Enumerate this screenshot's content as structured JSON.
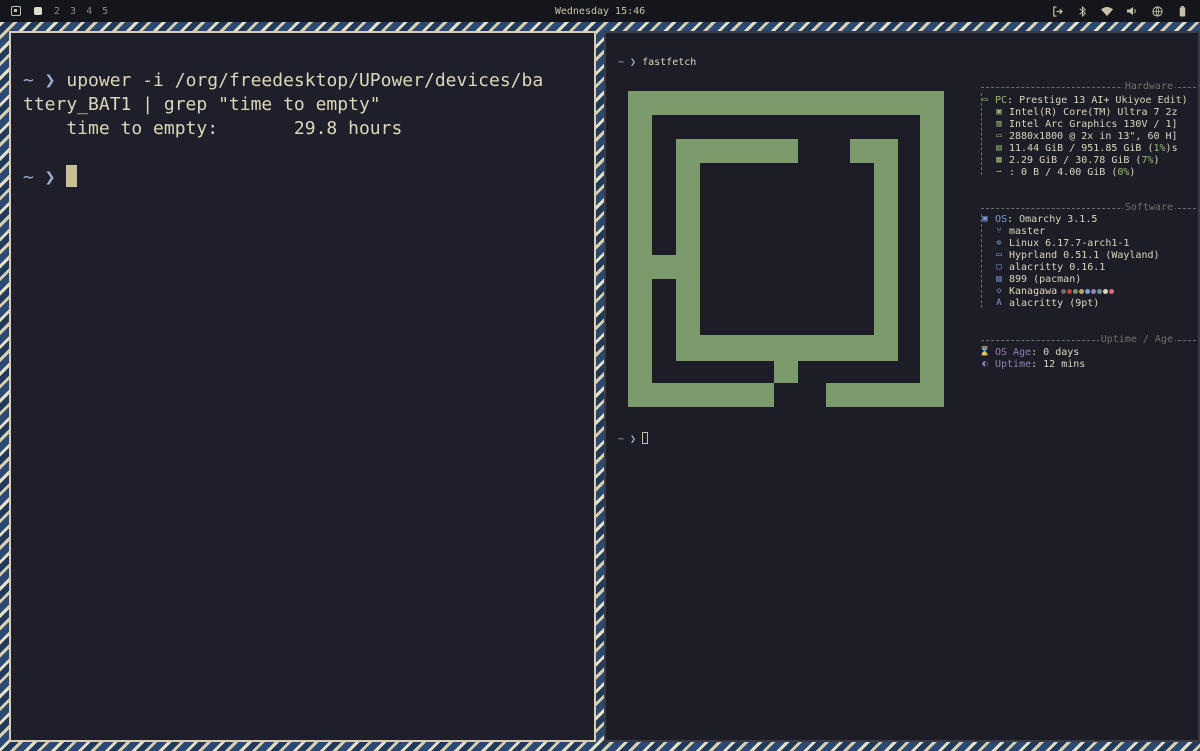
{
  "topbar": {
    "workspaces": [
      "2",
      "3",
      "4",
      "5"
    ],
    "clock": "Wednesday 15:46"
  },
  "left_terminal": {
    "prompt_symbol": "~ ❯",
    "command_line1": "upower -i /org/freedesktop/UPower/devices/ba",
    "command_line2": "ttery_BAT1 | grep \"time to empty\"",
    "output": "    time to empty:       29.8 hours"
  },
  "right_terminal": {
    "prompt_symbol": "~ ❯",
    "command": "fastfetch",
    "sections": {
      "hardware": "Hardware",
      "software": "Software",
      "uptime": "Uptime / Age"
    },
    "hardware": [
      {
        "icon": "pc-icon",
        "key": "PC",
        "value": "Prestige 13 AI+ Ukiyoe Edit)"
      },
      {
        "icon": "cpu-icon",
        "key": "",
        "value": "Intel(R) Core(TM) Ultra 7 2z"
      },
      {
        "icon": "gpu-icon",
        "key": "",
        "value": "Intel Arc Graphics 130V / 1]"
      },
      {
        "icon": "display-icon",
        "key": "",
        "value": "2880x1800 @ 2x in 13\", 60 H]"
      },
      {
        "icon": "disk-icon",
        "key": "",
        "value": "11.44 GiB / 951.85 GiB (",
        "pct": "1%",
        "tail": ")s"
      },
      {
        "icon": "memory-icon",
        "key": "",
        "value": "2.29 GiB / 30.78 GiB (",
        "pct": "7%",
        "tail": ")"
      },
      {
        "icon": "swap-icon",
        "key": "",
        "value": ": 0 B / 4.00 GiB (",
        "pct": "0%",
        "tail": ")"
      }
    ],
    "software": [
      {
        "icon": "os-icon",
        "key": "OS",
        "value": "Omarchy 3.1.5"
      },
      {
        "icon": "branch-icon",
        "key": "",
        "value": "master"
      },
      {
        "icon": "kernel-gear-icon",
        "key": "",
        "value": "Linux 6.17.7-arch1-1"
      },
      {
        "icon": "window-manager-icon",
        "key": "",
        "value": "Hyprland 0.51.1 (Wayland)"
      },
      {
        "icon": "terminal-icon",
        "key": "",
        "value": "alacritty 0.16.1"
      },
      {
        "icon": "package-icon",
        "key": "",
        "value": "899 (pacman)"
      },
      {
        "icon": "theme-icon",
        "key": "",
        "value": "Kanagawa"
      },
      {
        "icon": "font-icon",
        "key": "",
        "value": "alacritty (9pt)"
      }
    ],
    "uptime": [
      {
        "icon": "hourglass-icon",
        "key": "OS Age",
        "value": ": 0 days"
      },
      {
        "icon": "uptime-icon",
        "key": "Uptime",
        "value": ": 12 mins"
      }
    ],
    "theme_swatches": [
      "#727169",
      "#c34043",
      "#76946a",
      "#c0a36e",
      "#7e9cd8",
      "#957fb8",
      "#6a9589",
      "#dcd7ba",
      "#e46876"
    ]
  },
  "colors": {
    "logo": "#7c9a6b",
    "accent_green": "#98bb6c",
    "accent_blue": "#7e9cd8",
    "accent_purple": "#957fb8",
    "text": "#dcd7ba"
  }
}
